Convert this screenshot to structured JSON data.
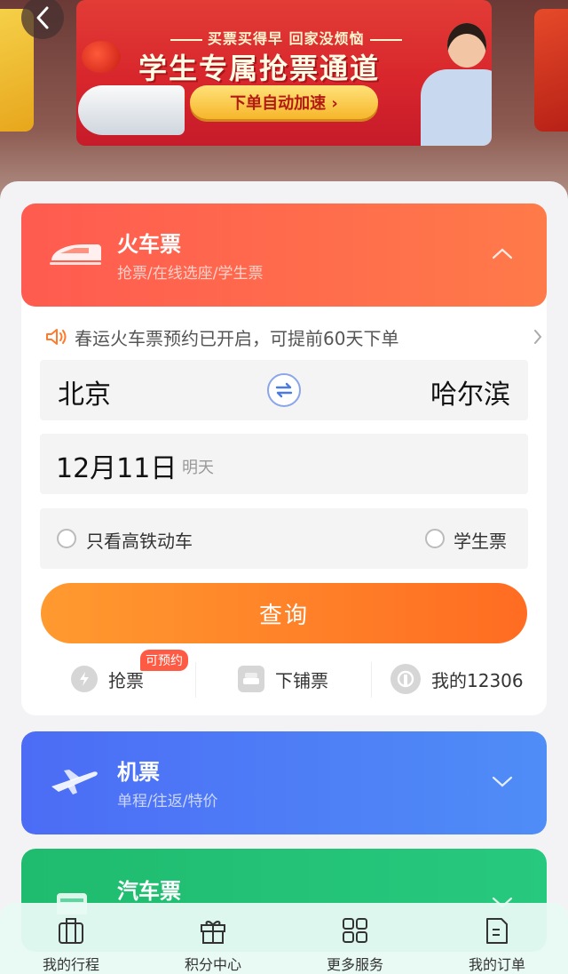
{
  "banner": {
    "subtitle": "买票买得早 回家没烦恼",
    "title": "学生专属抢票通道",
    "cta": "下单自动加速 ›"
  },
  "train": {
    "title": "火车票",
    "subtitle": "抢票/在线选座/学生票",
    "notice": "春运火车票预约已开启，可提前60天下单",
    "from_city": "北京",
    "to_city": "哈尔滨",
    "date": "12月11日",
    "date_tag": "明天",
    "option_highspeed": "只看高铁动车",
    "option_student": "学生票",
    "search_label": "查询",
    "quick_grab": "抢票",
    "quick_grab_badge": "可预约",
    "quick_lower_berth": "下铺票",
    "quick_my12306": "我的12306"
  },
  "flight": {
    "title": "机票",
    "subtitle": "单程/往返/特价"
  },
  "bus": {
    "title": "汽车票"
  },
  "tabs": [
    {
      "label": "我的行程",
      "icon": "suitcase-icon"
    },
    {
      "label": "积分中心",
      "icon": "gift-icon"
    },
    {
      "label": "更多服务",
      "icon": "grid-icon"
    },
    {
      "label": "我的订单",
      "icon": "document-icon"
    }
  ],
  "colors": {
    "train_gradient": [
      "#ff5b50",
      "#ff7a49"
    ],
    "flight_gradient": [
      "#4c6cf5",
      "#4f8df7"
    ],
    "bus_gradient": [
      "#1fbb6e",
      "#27c97f"
    ],
    "search_gradient": [
      "#ff9a2f",
      "#ff6c22"
    ]
  }
}
